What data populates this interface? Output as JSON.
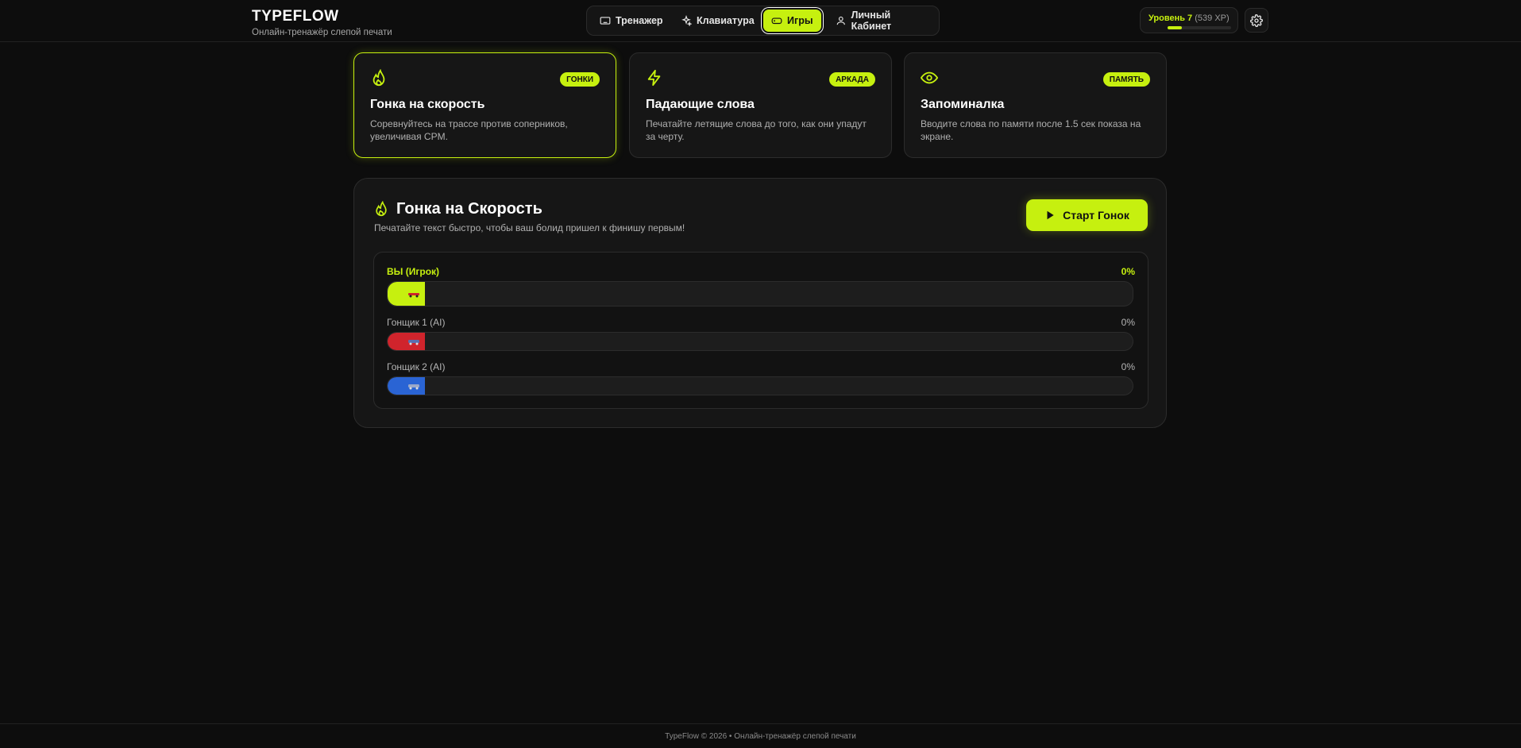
{
  "brand": {
    "title": "TYPEFLOW",
    "subtitle": "Онлайн-тренажёр слепой печати"
  },
  "nav": [
    {
      "label": "Тренажер",
      "icon": "keyboard-icon",
      "active": false
    },
    {
      "label": "Клавиатура",
      "icon": "sparkles-icon",
      "active": false
    },
    {
      "label": "Игры",
      "icon": "gamepad-icon",
      "active": true
    },
    {
      "label": "Личный Кабинет",
      "icon": "user-icon",
      "active": false
    }
  ],
  "level": {
    "label": "Уровень 7",
    "xp": "(539 XP)",
    "progress": 0.22
  },
  "settings": {
    "icon": "gear-icon"
  },
  "games": [
    {
      "title": "Гонка на скорость",
      "badge": "ГОНКИ",
      "icon": "flame-icon",
      "description": "Соревнуйтесь на трассе против соперников, увеличивая CPM.",
      "active": true
    },
    {
      "title": "Падающие слова",
      "badge": "АРКАДА",
      "icon": "lightning-icon",
      "description": "Печатайте летящие слова до того, как они упадут за черту.",
      "active": false
    },
    {
      "title": "Запоминалка",
      "badge": "ПАМЯТЬ",
      "icon": "eye-icon",
      "description": "Вводите слова по памяти после 1.5 сек показа на экране.",
      "active": false
    }
  ],
  "race": {
    "title": "Гонка на Скорость",
    "subtitle": "Печатайте текст быстро, чтобы ваш болид пришел к финишу первым!",
    "start_label": "Старт Гонок",
    "racers": [
      {
        "name": "ВЫ (Игрок)",
        "percent": "0%",
        "progress": 0,
        "color": "#c6f00f",
        "player": true
      },
      {
        "name": "Гонщик 1 (AI)",
        "percent": "0%",
        "progress": 0,
        "color": "#d0242c",
        "player": false
      },
      {
        "name": "Гонщик 2 (AI)",
        "percent": "0%",
        "progress": 0,
        "color": "#2a64d4",
        "player": false
      }
    ]
  },
  "footer": {
    "text": "TypeFlow © 2026 • Онлайн-тренажёр слепой печати"
  },
  "colors": {
    "accent": "#c6f00f",
    "background": "#0d0d0d",
    "card": "#161616"
  }
}
